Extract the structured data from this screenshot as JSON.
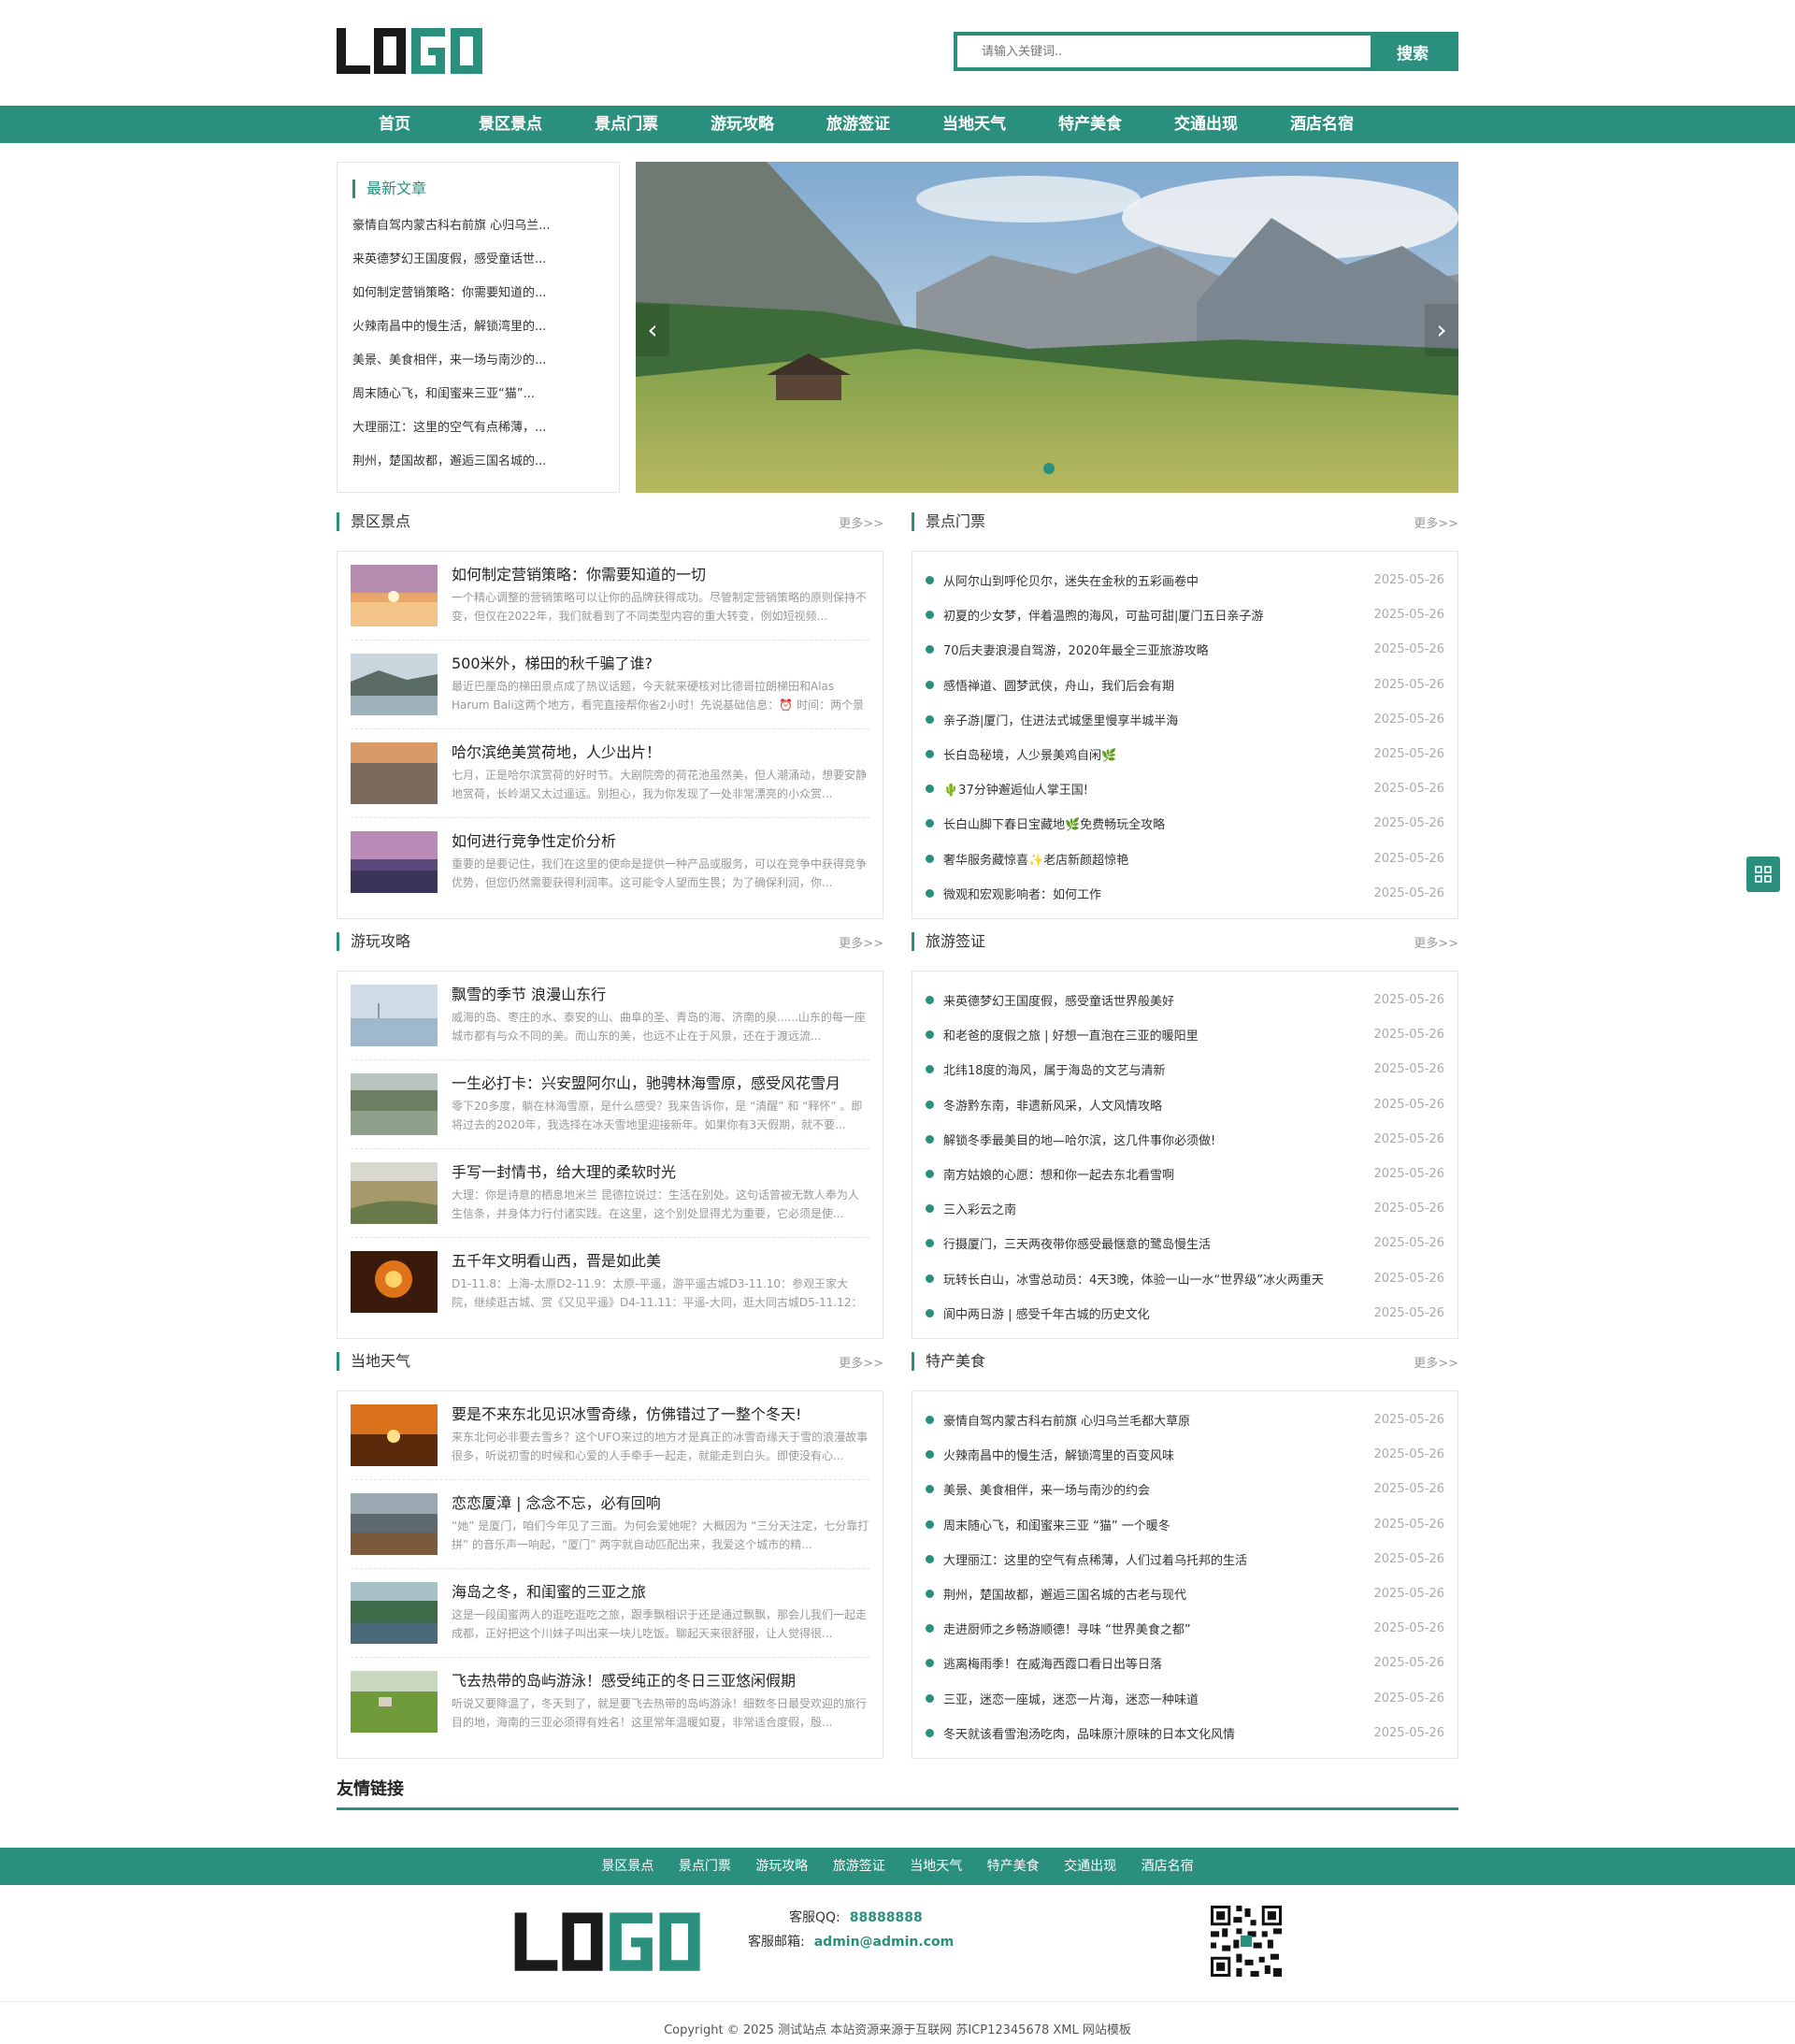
{
  "header": {
    "search_placeholder": "请输入关键词..",
    "search_button": "搜索"
  },
  "nav": [
    "首页",
    "景区景点",
    "景点门票",
    "游玩攻略",
    "旅游签证",
    "当地天气",
    "特产美食",
    "交通出现",
    "酒店名宿"
  ],
  "latest": {
    "title": "最新文章",
    "items": [
      "豪情自驾内蒙古科右前旗 心归乌兰...",
      "来英德梦幻王国度假，感受童话世...",
      "如何制定营销策略：你需要知道的...",
      "火辣南昌中的慢生活，解锁湾里的...",
      "美景、美食相伴，来一场与南沙的...",
      "周末随心飞，和闺蜜来三亚“猫”...",
      "大理丽江：这里的空气有点稀薄，...",
      "荆州，楚国故都，邂逅三国名城的..."
    ]
  },
  "sections": {
    "scenic": {
      "title": "景区景点",
      "more": "更多>>",
      "articles": [
        {
          "title": "如何制定营销策略：你需要知道的一切",
          "desc": "一个精心调整的营销策略可以让你的品牌获得成功。尽管制定营销策略的原则保持不变，但仅在2022年，我们就看到了不同类型内容的重大转变，例如短视频..."
        },
        {
          "title": "500米外，梯田的秋千骗了谁?",
          "desc": "最近巴厘岛的梯田景点成了热议话题，今天就来硬核对比德哥拉朗梯田和Alas Harum Bali这两个地方，看完直接帮你省2小时！先说基础信息：⏰ 时间：两个景"
        },
        {
          "title": "哈尔滨绝美赏荷地，人少出片！",
          "desc": "七月，正是哈尔滨赏荷的好时节。大剧院旁的荷花池虽然美，但人潮涌动，想要安静地赏荷，长岭湖又太过遥远。别担心，我为你发现了一处非常漂亮的小众赏..."
        },
        {
          "title": "如何进行竞争性定价分析",
          "desc": "重要的是要记住，我们在这里的使命是提供一种产品或服务，可以在竞争中获得竞争优势，但您仍然需要获得利润率。这可能令人望而生畏；为了确保利润，你..."
        }
      ]
    },
    "tickets": {
      "title": "景点门票",
      "more": "更多>>",
      "items": [
        {
          "t": "从阿尔山到呼伦贝尔，迷失在金秋的五彩画卷中",
          "d": "2025-05-26"
        },
        {
          "t": "初夏的少女梦，伴着温煦的海风，可盐可甜|厦门五日亲子游",
          "d": "2025-05-26"
        },
        {
          "t": "70后夫妻浪漫自驾游，2020年最全三亚旅游攻略",
          "d": "2025-05-26"
        },
        {
          "t": "感悟禅道、圆梦武侠，舟山，我们后会有期",
          "d": "2025-05-26"
        },
        {
          "t": "亲子游|厦门，住进法式城堡里慢享半城半海",
          "d": "2025-05-26"
        },
        {
          "t": "长白岛秘境，人少景美鸡自闲🌿",
          "d": "2025-05-26"
        },
        {
          "t": "🌵37分钟邂逅仙人掌王国!",
          "d": "2025-05-26"
        },
        {
          "t": "长白山脚下春日宝藏地🌿免费畅玩全攻略",
          "d": "2025-05-26"
        },
        {
          "t": "奢华服务藏惊喜✨老店新颜超惊艳",
          "d": "2025-05-26"
        },
        {
          "t": "微观和宏观影响者：如何工作",
          "d": "2025-05-26"
        }
      ]
    },
    "guides": {
      "title": "游玩攻略",
      "more": "更多>>",
      "articles": [
        {
          "title": "飘雪的季节 浪漫山东行",
          "desc": "威海的岛、枣庄的水、泰安的山、曲阜的圣、青岛的海、济南的泉......山东的每一座城市都有与众不同的美。而山东的美，也远不止在于风景，还在于渡远流..."
        },
        {
          "title": "一生必打卡：兴安盟阿尔山，驰骋林海雪原，感受风花雪月",
          "desc": "零下20多度，躺在林海雪原，是什么感受？我来告诉你，是 “清醒” 和 “释怀” 。即将过去的2020年，我选择在冰天雪地里迎接新年。如果你有3天假期，就不要..."
        },
        {
          "title": "手写一封情书，给大理的柔软时光",
          "desc": "大理：你是诗意的栖息地米兰 昆德拉说过：生活在别处。这句话曾被无数人奉为人生信条，并身体力行付诸实践。在这里，这个别处显得尤为重要，它必须是使..."
        },
        {
          "title": "五千年文明看山西，晋是如此美",
          "desc": "D1-11.8：上海-太原D2-11.9：太原-平遥，游平遥古城D3-11.10：参观王家大院，继续逛古城、赏《又见平遥》D4-11.11：平遥-大同，逛大同古城D5-11.12：参..."
        }
      ]
    },
    "visa": {
      "title": "旅游签证",
      "more": "更多>>",
      "items": [
        {
          "t": "来英德梦幻王国度假，感受童话世界般美好",
          "d": "2025-05-26"
        },
        {
          "t": "和老爸的度假之旅 | 好想一直泡在三亚的暖阳里",
          "d": "2025-05-26"
        },
        {
          "t": "北纬18度的海风，属于海岛的文艺与清新",
          "d": "2025-05-26"
        },
        {
          "t": "冬游黔东南，非遗新风采，人文风情攻略",
          "d": "2025-05-26"
        },
        {
          "t": "解锁冬季最美目的地—哈尔滨，这几件事你必须做!",
          "d": "2025-05-26"
        },
        {
          "t": "南方姑娘的心愿：想和你一起去东北看雪啊",
          "d": "2025-05-26"
        },
        {
          "t": "三入彩云之南",
          "d": "2025-05-26"
        },
        {
          "t": "行摄厦门，三天两夜带你感受最惬意的鹭岛慢生活",
          "d": "2025-05-26"
        },
        {
          "t": "玩转长白山，冰雪总动员：4天3晚，体验一山一水“世界级”冰火两重天",
          "d": "2025-05-26"
        },
        {
          "t": "阆中两日游 | 感受千年古城的历史文化",
          "d": "2025-05-26"
        }
      ]
    },
    "weather": {
      "title": "当地天气",
      "more": "更多>>",
      "articles": [
        {
          "title": "要是不来东北见识冰雪奇缘，仿佛错过了一整个冬天!",
          "desc": "来东北何必非要去雪乡？这个UFO来过的地方才是真正的冰雪奇缘天于雪的浪漫故事很多，听说初雪的时候和心爱的人手牵手一起走，就能走到白头。即使没有心..."
        },
        {
          "title": "恋恋厦漳 | 念念不忘，必有回响",
          "desc": "“她” 是厦门，咱们今年见了三面。为何会爱她呢？大概因为 “三分天注定，七分靠打拼” 的音乐声一响起，“厦门” 两字就自动匹配出来，我爱这个城市的精..."
        },
        {
          "title": "海岛之冬，和闺蜜的三亚之旅",
          "desc": "这是一段闺蜜两人的逛吃逛吃之旅，跟季飘相识于还是通过飘飘，那会儿我们一起走成都，正好把这个川妹子叫出来一块儿吃饭。聊起天来很舒服，让人觉得很..."
        },
        {
          "title": "飞去热带的岛屿游泳！感受纯正的冬日三亚悠闲假期",
          "desc": "听说又要降温了，冬天到了，就是要飞去热带的岛屿游泳！细数冬日最受欢迎的旅行目的地，海南的三亚必须得有姓名！这里常年温暖如夏，非常适合度假，殷..."
        }
      ]
    },
    "food": {
      "title": "特产美食",
      "more": "更多>>",
      "items": [
        {
          "t": "豪情自驾内蒙古科右前旗 心归乌兰毛都大草原",
          "d": "2025-05-26"
        },
        {
          "t": "火辣南昌中的慢生活，解锁湾里的百变风味",
          "d": "2025-05-26"
        },
        {
          "t": "美景、美食相伴，来一场与南沙的约会",
          "d": "2025-05-26"
        },
        {
          "t": "周末随心飞，和闺蜜来三亚 “猫” 一个暖冬",
          "d": "2025-05-26"
        },
        {
          "t": "大理丽江：这里的空气有点稀薄，人们过着乌托邦的生活",
          "d": "2025-05-26"
        },
        {
          "t": "荆州，楚国故都，邂逅三国名城的古老与现代",
          "d": "2025-05-26"
        },
        {
          "t": "走进厨师之乡畅游顺德！寻味 “世界美食之都”",
          "d": "2025-05-26"
        },
        {
          "t": "逃离梅雨季！在威海西霞口看日出等日落",
          "d": "2025-05-26"
        },
        {
          "t": "三亚，迷恋一座城，迷恋一片海，迷恋一种味道",
          "d": "2025-05-26"
        },
        {
          "t": "冬天就该看雪泡汤吃肉，品味原汁原味的日本文化风情",
          "d": "2025-05-26"
        }
      ]
    }
  },
  "friend_links_title": "友情链接",
  "footer": {
    "nav": [
      "景区景点",
      "景点门票",
      "游玩攻略",
      "旅游签证",
      "当地天气",
      "特产美食",
      "交通出现",
      "酒店名宿"
    ],
    "qq_label": "客服QQ:",
    "qq": "88888888",
    "email_label": "客服邮箱:",
    "email": "admin@admin.com",
    "copyright": "Copyright © 2025 测试站点 本站资源来源于互联网 苏ICP12345678 XML 网站模板"
  },
  "colors": {
    "accent": "#2a8f7c"
  }
}
